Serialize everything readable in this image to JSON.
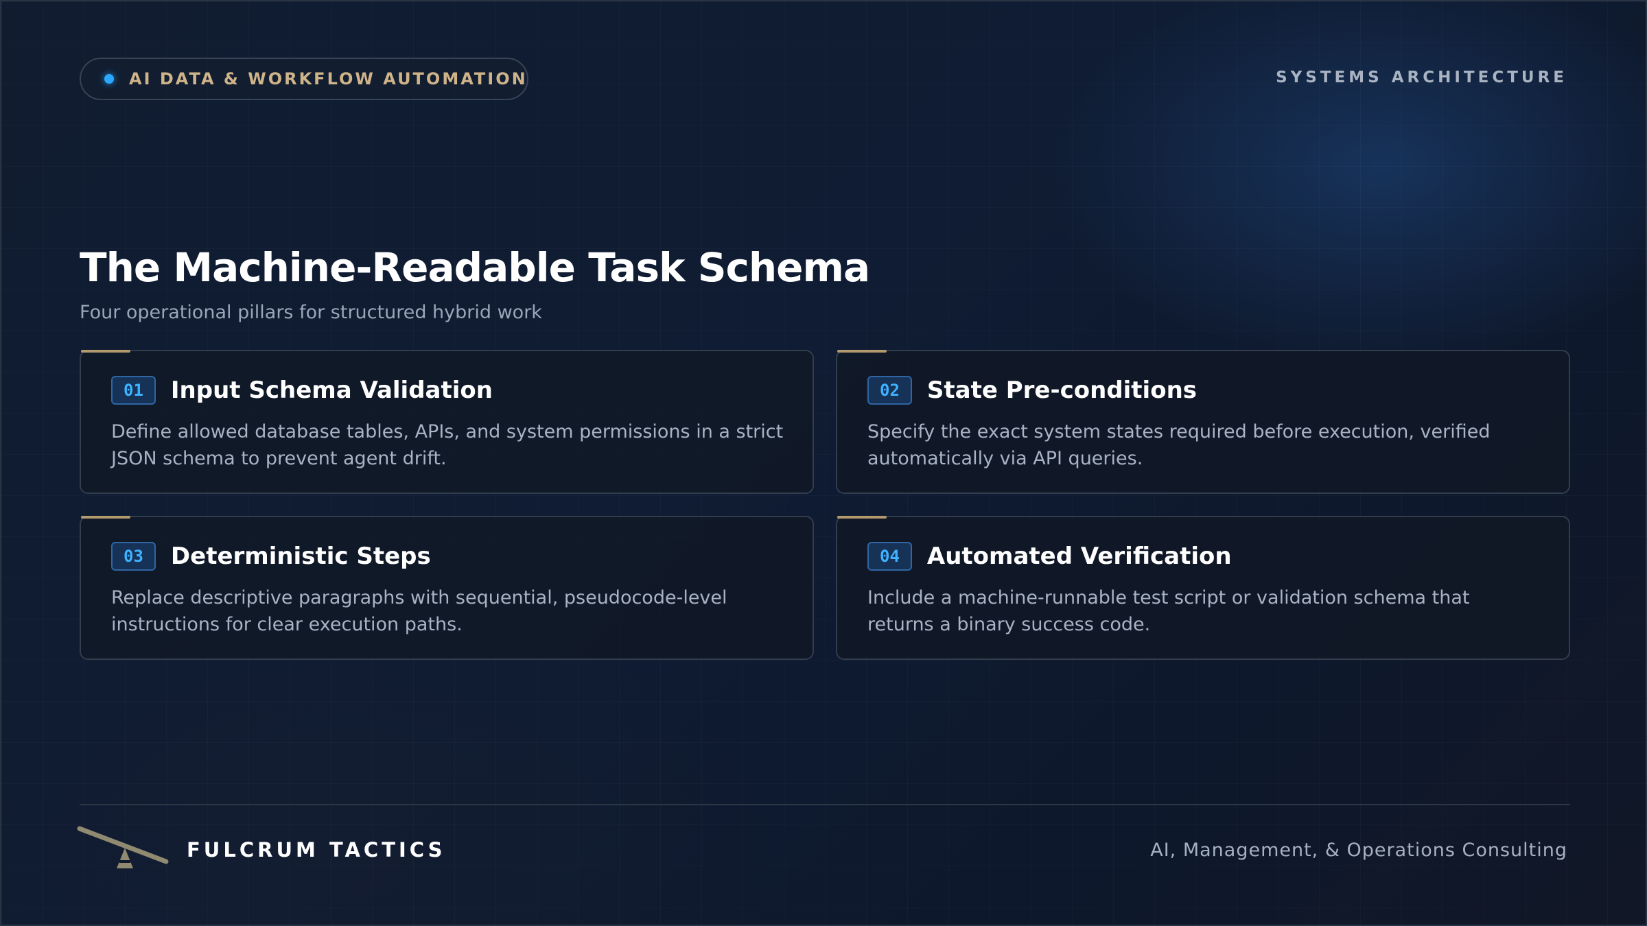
{
  "header": {
    "badge_label": "AI DATA & WORKFLOW AUTOMATION",
    "section_label": "SYSTEMS ARCHITECTURE"
  },
  "main": {
    "title": "The Machine-Readable Task Schema",
    "subtitle": "Four operational pillars for structured hybrid work",
    "cards": [
      {
        "number": "01",
        "title": "Input Schema Validation",
        "description": "Define allowed database tables, APIs, and system permissions in a strict JSON schema to prevent agent drift."
      },
      {
        "number": "02",
        "title": "State Pre-conditions",
        "description": "Specify the exact system states required before execution, verified automatically via API queries."
      },
      {
        "number": "03",
        "title": "Deterministic Steps",
        "description": "Replace descriptive paragraphs with sequential, pseudocode-level instructions for clear execution paths."
      },
      {
        "number": "04",
        "title": "Automated Verification",
        "description": "Include a machine-runnable test script or validation schema that returns a binary success code."
      }
    ]
  },
  "footer": {
    "brand": "FULCRUM TACTICS",
    "tagline": "AI, Management, & Operations Consulting",
    "logo_icon": "fulcrum-lever-icon"
  },
  "colors": {
    "accent_blue": "#2aa8ff",
    "accent_gold": "#b39a6e",
    "background": "#0f1a2e"
  }
}
